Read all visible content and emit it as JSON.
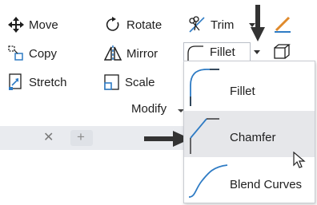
{
  "ribbon": {
    "col1": {
      "move": "Move",
      "copy": "Copy",
      "stretch": "Stretch"
    },
    "col2": {
      "rotate": "Rotate",
      "mirror": "Mirror",
      "scale": "Scale"
    },
    "col3": {
      "trim": "Trim",
      "fillet": "Fillet"
    },
    "panel_title": "Modify"
  },
  "tabs": {
    "close_glyph": "✕",
    "add_glyph": "+"
  },
  "dropdown": {
    "items": [
      {
        "label": "Fillet",
        "icon": "fillet-curve-icon"
      },
      {
        "label": "Chamfer",
        "icon": "chamfer-line-icon",
        "highlighted": true
      },
      {
        "label": "Blend Curves",
        "icon": "blend-curve-icon"
      }
    ]
  },
  "colors": {
    "accent_blue": "#2e7bc4",
    "hover_bg": "#e6e7ea",
    "arrow": "#333333",
    "pencil_orange": "#e08a2c"
  }
}
